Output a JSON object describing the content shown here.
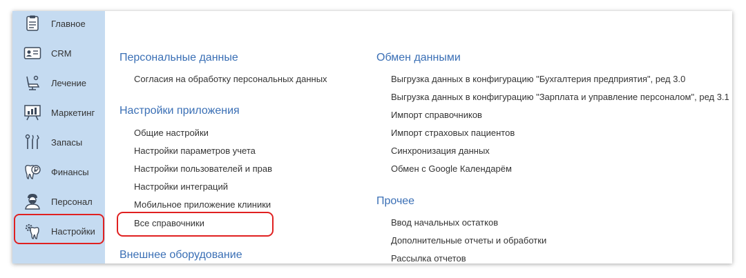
{
  "colors": {
    "sidebar_bg": "#c5dbf1",
    "section_title": "#3a6fb5",
    "highlight": "#e02020",
    "text": "#333333"
  },
  "sidebar": {
    "items": [
      {
        "label": "Главное",
        "icon": "dashboard-icon"
      },
      {
        "label": "CRM",
        "icon": "id-card-icon"
      },
      {
        "label": "Лечение",
        "icon": "dental-chair-icon"
      },
      {
        "label": "Маркетинг",
        "icon": "chart-board-icon"
      },
      {
        "label": "Запасы",
        "icon": "dental-tools-icon"
      },
      {
        "label": "Финансы",
        "icon": "tooth-ruble-icon"
      },
      {
        "label": "Персонал",
        "icon": "doctor-icon"
      },
      {
        "label": "Настройки",
        "icon": "tooth-gear-icon"
      }
    ],
    "active": "Настройки"
  },
  "main": {
    "left": {
      "personal_data": {
        "title": "Персональные данные",
        "links": [
          "Согласия на обработку персональных данных"
        ]
      },
      "app_settings": {
        "title": "Настройки приложения",
        "links": [
          "Общие настройки",
          "Настройки параметров учета",
          "Настройки пользователей и прав",
          "Настройки интеграций",
          "Мобильное приложение клиники",
          "Все справочники"
        ]
      },
      "external_equipment": {
        "title": "Внешнее оборудование"
      }
    },
    "right": {
      "data_exchange": {
        "title": "Обмен данными",
        "links": [
          "Выгрузка данных в конфигурацию \"Бухгалтерия предприятия\", ред 3.0",
          "Выгрузка данных в конфигурацию \"Зарплата и управление персоналом\", ред 3.1",
          "Импорт справочников",
          "Импорт страховых пациентов",
          "Синхронизация данных",
          "Обмен с Google Календарём"
        ]
      },
      "other": {
        "title": "Прочее",
        "links": [
          "Ввод начальных остатков",
          "Дополнительные отчеты и обработки",
          "Рассылка отчетов"
        ]
      }
    }
  }
}
